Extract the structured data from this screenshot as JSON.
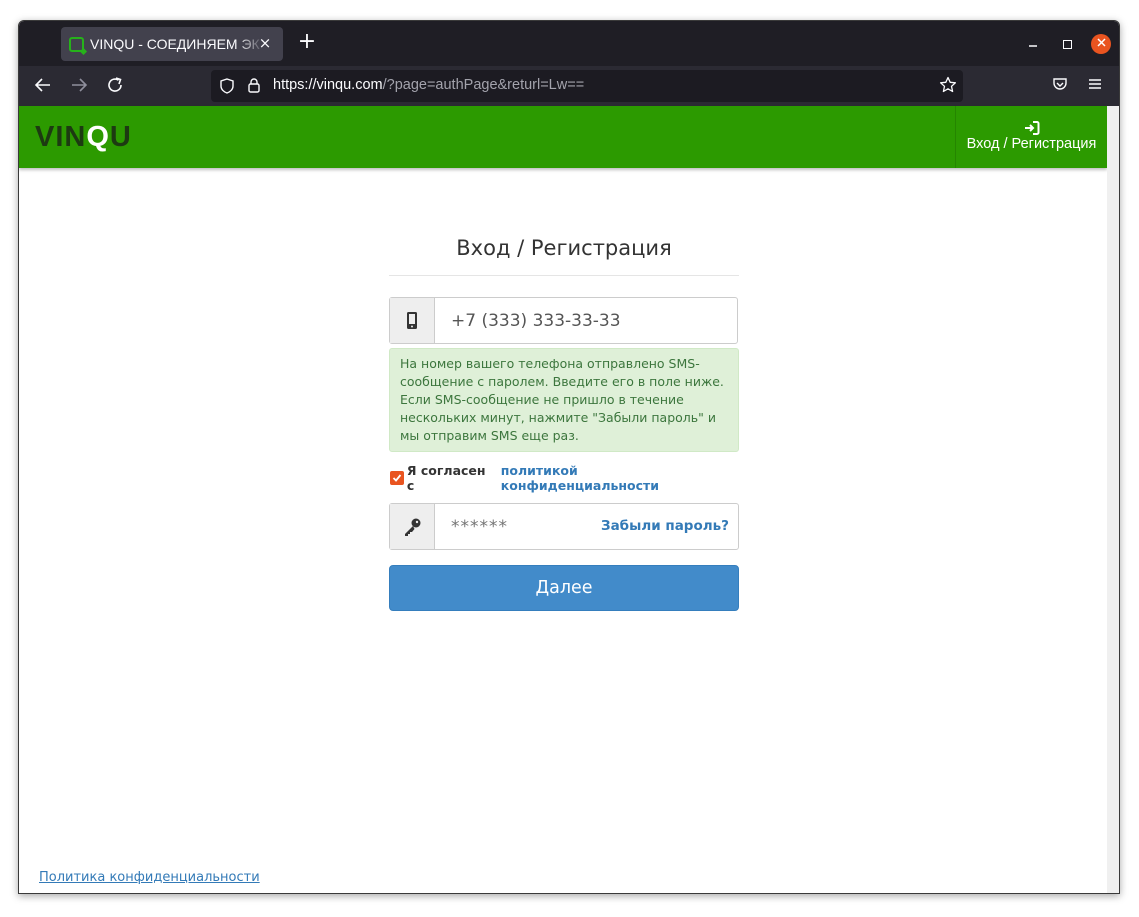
{
  "browser": {
    "tab_title": "VINQU - СОЕДИНЯЕМ ЭК",
    "tab_close": "×",
    "new_tab": "+",
    "url_host": "https://vinqu.com",
    "url_path": "/?page=authPage&returl=Lw=="
  },
  "header": {
    "logo_prefix": "VIN",
    "logo_q": "Q",
    "logo_suffix": "U",
    "login_label": "Вход / Регистрация",
    "brand_color": "#2c9a00"
  },
  "form": {
    "title": "Вход / Регистрация",
    "phone_value": "+7 (333) 333-33-33",
    "sms_notice": "На номер вашего телефона отправлено SMS-сообщение с паролем. Введите его в поле ниже. Если SMS-сообщение не пришло в течение нескольких минут, нажмите \"Забыли пароль\" и мы отправим SMS еще раз.",
    "agree_text": "Я согласен с",
    "agree_link": "политикой конфиденциальности",
    "agree_checked": true,
    "password_placeholder": "******",
    "forgot_label": "Забыли пароль?",
    "submit_label": "Далее"
  },
  "footer": {
    "privacy_link": "Политика конфиденциальности"
  }
}
